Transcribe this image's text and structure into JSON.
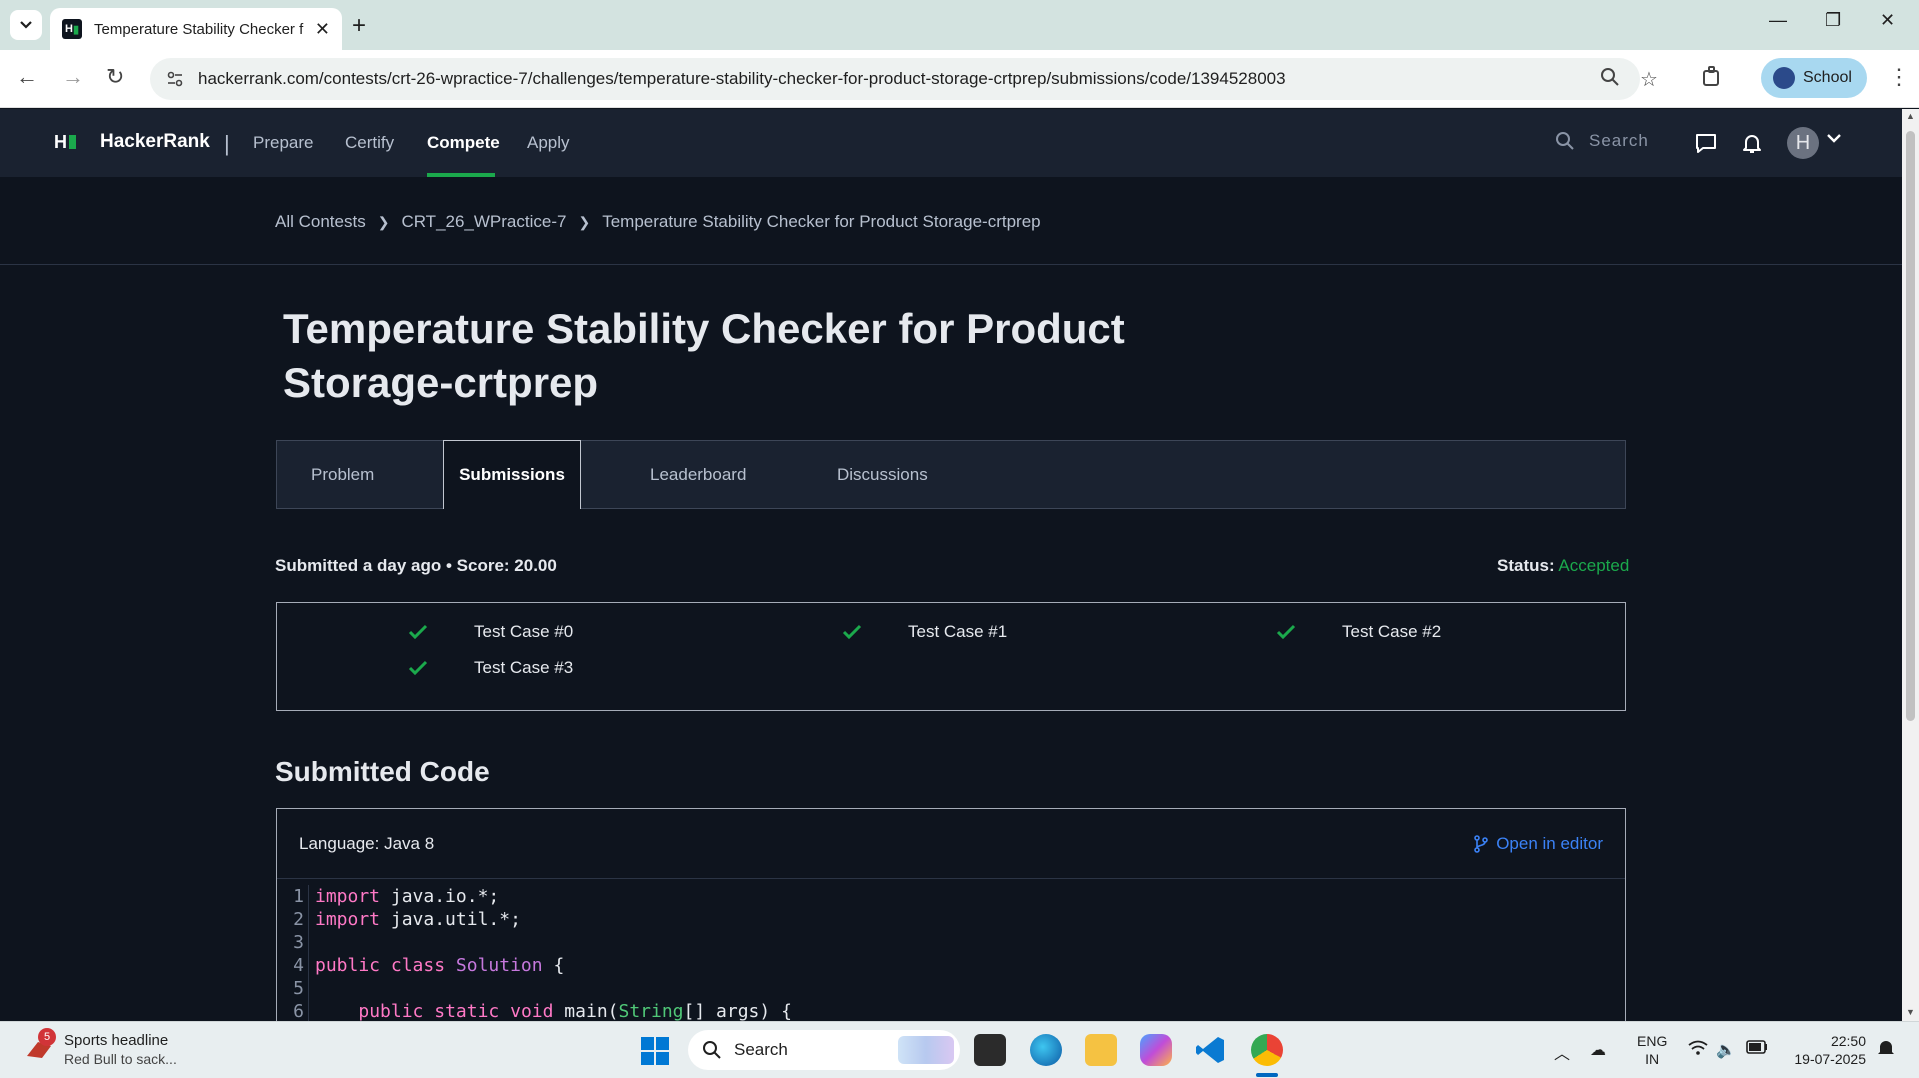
{
  "browser": {
    "tab_title": "Temperature Stability Checker f",
    "url": "hackerrank.com/contests/crt-26-wpractice-7/challenges/temperature-stability-checker-for-product-storage-crtprep/submissions/code/1394528003",
    "profile_label": "School"
  },
  "header": {
    "brand": "HackerRank",
    "separator": "|",
    "nav": [
      "Prepare",
      "Certify",
      "Compete",
      "Apply"
    ],
    "search_placeholder": "Search"
  },
  "breadcrumb": [
    "All Contests",
    "CRT_26_WPractice-7",
    "Temperature Stability Checker for Product Storage-crtprep"
  ],
  "page_title": "Temperature Stability Checker for Product Storage-crtprep",
  "tabs": [
    "Problem",
    "Submissions",
    "Leaderboard",
    "Discussions"
  ],
  "submission": {
    "summary": "Submitted a day ago • Score: 20.00",
    "status_label": "Status:",
    "status_value": "Accepted",
    "status_color": "#1ba94c"
  },
  "test_cases": [
    "Test Case #0",
    "Test Case #1",
    "Test Case #2",
    "Test Case #3"
  ],
  "code": {
    "section_title": "Submitted Code",
    "language": "Language: Java 8",
    "open_in_editor": "Open in editor",
    "line_numbers": [
      "1",
      "2",
      "3",
      "4",
      "5",
      "6"
    ]
  },
  "taskbar": {
    "news_badge": "5",
    "news_title": "Sports headline",
    "news_sub": "Red Bull to sack...",
    "search_label": "Search",
    "lang_1": "ENG",
    "lang_2": "IN",
    "time": "22:50",
    "date": "19-07-2025"
  }
}
